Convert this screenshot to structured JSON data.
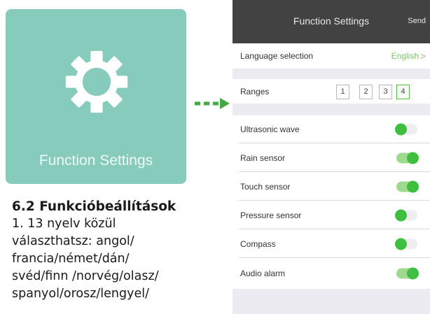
{
  "tile": {
    "label": "Function Settings",
    "icon": "gear-icon"
  },
  "doc": {
    "title": "6.2 Funkcióbeállítások",
    "lines": [
      "1. 13 nyelv közül",
      "választhatsz: angol/",
      "francia/német/dán/",
      "svéd/finn /norvég/olasz/",
      "spanyol/orosz/lengyel/"
    ]
  },
  "phone": {
    "header": {
      "title": "Function Settings",
      "send": "Send"
    },
    "language": {
      "label": "Language selection",
      "value": "English",
      "chevron": ">"
    },
    "ranges": {
      "label": "Ranges",
      "options": [
        "1",
        "2",
        "3",
        "4"
      ],
      "selected": "4"
    },
    "toggles": [
      {
        "label": "Ultrasonic wave",
        "state": "off"
      },
      {
        "label": "Rain sensor",
        "state": "on"
      },
      {
        "label": "Touch sensor",
        "state": "on"
      },
      {
        "label": "Pressure sensor",
        "state": "off"
      },
      {
        "label": "Compass",
        "state": "off"
      },
      {
        "label": "Audio alarm",
        "state": "on"
      }
    ]
  },
  "colors": {
    "tile": "#86cbbc",
    "header": "#424242",
    "accent": "#3fbf3f",
    "arrow": "#43a943"
  }
}
